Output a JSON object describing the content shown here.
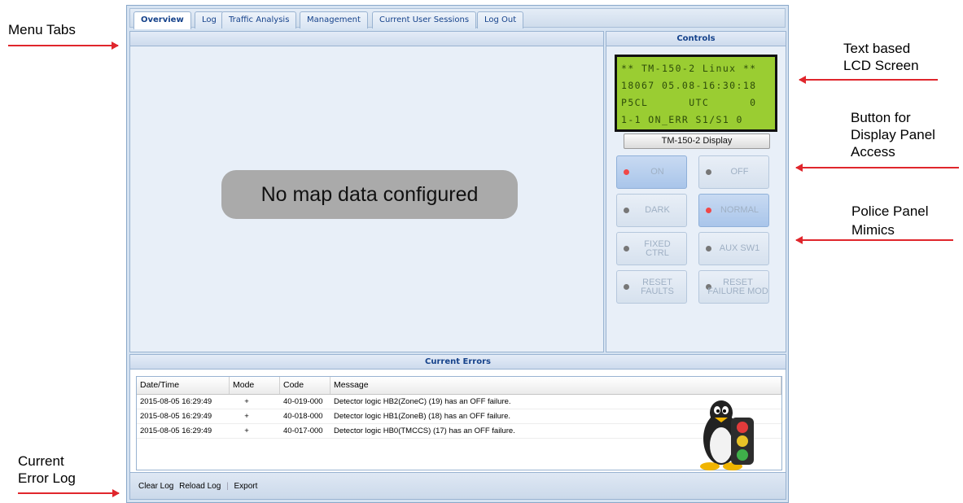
{
  "annotations": {
    "menu_tabs": "Menu Tabs",
    "current_error_log_line1": "Current",
    "current_error_log_line2": "Error Log",
    "lcd_line1": "Text based",
    "lcd_line2": "LCD Screen",
    "display_btn_line1": "Button for",
    "display_btn_line2": "Display Panel",
    "display_btn_line3": "Access",
    "police_line1": "Police Panel",
    "police_line2": "Mimics"
  },
  "tabs": [
    {
      "label": "Overview",
      "active": true
    },
    {
      "label": "Log"
    },
    {
      "label": "Traffic Analysis"
    },
    {
      "label": "Management"
    },
    {
      "label": "Current User Sessions"
    },
    {
      "label": "Log Out"
    }
  ],
  "map": {
    "message": "No map data configured"
  },
  "controls": {
    "title": "Controls",
    "lcd_lines": [
      "** TM-150-2 Linux **",
      "18067 05.08-16:30:18",
      "P5CL      UTC      0",
      "1-1 ON_ERR S1/S1 0"
    ],
    "display_button": "TM-150-2 Display",
    "buttons": [
      {
        "label": "ON",
        "led": "red",
        "pressed": true
      },
      {
        "label": "OFF",
        "led": "gray",
        "pressed": false
      },
      {
        "label": "DARK",
        "led": "gray",
        "pressed": false
      },
      {
        "label": "NORMAL",
        "led": "red",
        "pressed": true
      },
      {
        "label": "FIXED CTRL",
        "line1": "FIXED",
        "line2": "CTRL",
        "led": "gray",
        "pressed": false
      },
      {
        "label": "AUX SW1",
        "led": "gray",
        "pressed": false
      },
      {
        "label": "RESET FAULTS",
        "line1": "RESET",
        "line2": "FAULTS",
        "led": "gray",
        "pressed": false
      },
      {
        "label": "RESET FAILURE MOD",
        "line1": "RESET",
        "line2": "FAILURE MOD",
        "led": "gray",
        "pressed": false
      }
    ]
  },
  "errors": {
    "title": "Current Errors",
    "columns": [
      "Date/Time",
      "Mode",
      "Code",
      "Message"
    ],
    "rows": [
      [
        "2015-08-05 16:29:49",
        "+",
        "40-019-000",
        "Detector logic HB2(ZoneC) (19) has an OFF failure."
      ],
      [
        "2015-08-05 16:29:49",
        "+",
        "40-018-000",
        "Detector logic HB1(ZoneB) (18) has an OFF failure."
      ],
      [
        "2015-08-05 16:29:49",
        "+",
        "40-017-000",
        "Detector logic HB0(TMCCS) (17) has an OFF failure."
      ]
    ],
    "toolbar": {
      "clear": "Clear Log",
      "reload": "Reload Log",
      "export": "Export"
    }
  }
}
